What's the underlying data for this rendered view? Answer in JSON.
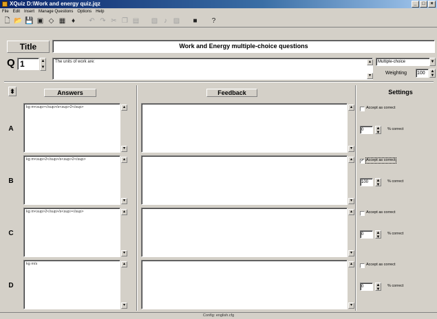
{
  "window": {
    "title": "XQuiz D:\\Work and energy quiz.jqz",
    "minimize": "_",
    "maximize": "□",
    "close": "×"
  },
  "menu": [
    "File",
    "Edit",
    "Insert",
    "Manage Questions",
    "Options",
    "Help"
  ],
  "toolbar": {
    "icons": [
      {
        "name": "new-icon",
        "glyph": "🗋",
        "dim": false
      },
      {
        "name": "open-icon",
        "glyph": "📂",
        "dim": false
      },
      {
        "name": "save-icon",
        "glyph": "💾",
        "dim": false
      },
      {
        "name": "save-all-icon",
        "glyph": "▣",
        "dim": false
      },
      {
        "name": "diamond-icon",
        "glyph": "◇",
        "dim": false
      },
      {
        "name": "grid-icon",
        "glyph": "▦",
        "dim": false
      },
      {
        "name": "pin-icon",
        "glyph": "♦",
        "dim": false
      },
      {
        "name": "undo-icon",
        "glyph": "↶",
        "dim": true
      },
      {
        "name": "redo-icon",
        "glyph": "↷",
        "dim": true
      },
      {
        "name": "cut-icon",
        "glyph": "✂",
        "dim": true
      },
      {
        "name": "copy-icon",
        "glyph": "❐",
        "dim": true
      },
      {
        "name": "paste-icon",
        "glyph": "▤",
        "dim": true
      },
      {
        "name": "image-icon",
        "glyph": "▧",
        "dim": true
      },
      {
        "name": "sound-icon",
        "glyph": "♪",
        "dim": true
      },
      {
        "name": "movie-icon",
        "glyph": "▨",
        "dim": true
      },
      {
        "name": "monitor-icon",
        "glyph": "■",
        "dim": false
      },
      {
        "name": "help-icon",
        "glyph": "?",
        "dim": false
      }
    ]
  },
  "title_label": "Title",
  "title_value": "Work and Energy multiple-choice questions",
  "question": {
    "label": "Q",
    "number": "1",
    "text": "The units of work are:",
    "type": "Multiple-choice",
    "weighting_label": "Weighting",
    "weighting": "100"
  },
  "headers": {
    "answers": "Answers",
    "feedback": "Feedback",
    "settings": "Settings"
  },
  "rows": [
    {
      "label": "A",
      "answer": "kg m<sup></sup>/s<sup>2</sup>",
      "feedback": "",
      "accept_label": "Accept as correct",
      "accepted": false,
      "percent": "0",
      "percent_label": "% correct"
    },
    {
      "label": "B",
      "answer": "kg m<sup>2</sup>/s<sup>2</sup>",
      "feedback": "",
      "accept_label": "Accept as correct",
      "accepted": true,
      "percent": "100",
      "percent_label": "% correct"
    },
    {
      "label": "C",
      "answer": "kg m<sup>2</sup>/s<sup></sup>",
      "feedback": "",
      "accept_label": "Accept as correct",
      "accepted": false,
      "percent": "0",
      "percent_label": "% correct"
    },
    {
      "label": "D",
      "answer": "kg m/s",
      "feedback": "",
      "accept_label": "Accept as correct",
      "accepted": false,
      "percent": "0",
      "percent_label": "% correct"
    }
  ],
  "status": "Config: english.cfg"
}
